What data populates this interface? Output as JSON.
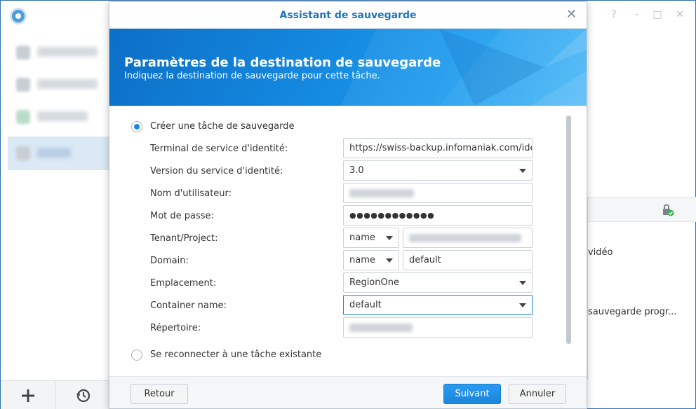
{
  "app": {
    "window_controls": [
      "?",
      "–",
      "□",
      "✕"
    ],
    "right_panel": {
      "text_1": "vidéo",
      "text_2": "sauvegarde progr..."
    }
  },
  "dialog": {
    "title": "Assistant de sauvegarde",
    "close_glyph": "✕",
    "banner": {
      "title": "Paramètres de la destination de sauvegarde",
      "subtitle": "Indiquez la destination de sauvegarde pour cette tâche."
    },
    "options": {
      "create_label": "Créer une tâche de sauvegarde",
      "reconnect_label": "Se reconnecter à une tâche existante",
      "selected": "create"
    },
    "fields": {
      "endpoint": {
        "label": "Terminal de service d'identité:",
        "value": "https://swiss-backup.infomaniak.com/ide"
      },
      "version": {
        "label": "Version du service d'identité:",
        "value": "3.0"
      },
      "username": {
        "label": "Nom d'utilisateur:"
      },
      "password": {
        "label": "Mot de passe:",
        "value": "●●●●●●●●●●●●"
      },
      "tenant": {
        "label": "Tenant/Project:",
        "mode": "name"
      },
      "domain": {
        "label": "Domain:",
        "mode": "name",
        "value": "default"
      },
      "location": {
        "label": "Emplacement:",
        "value": "RegionOne"
      },
      "container": {
        "label": "Container name:",
        "value": "default"
      },
      "directory": {
        "label": "Répertoire:"
      }
    },
    "footer": {
      "back": "Retour",
      "next": "Suivant",
      "cancel": "Annuler"
    }
  },
  "colors": {
    "accent": "#1c86e6",
    "title_blue": "#1c75bc"
  }
}
